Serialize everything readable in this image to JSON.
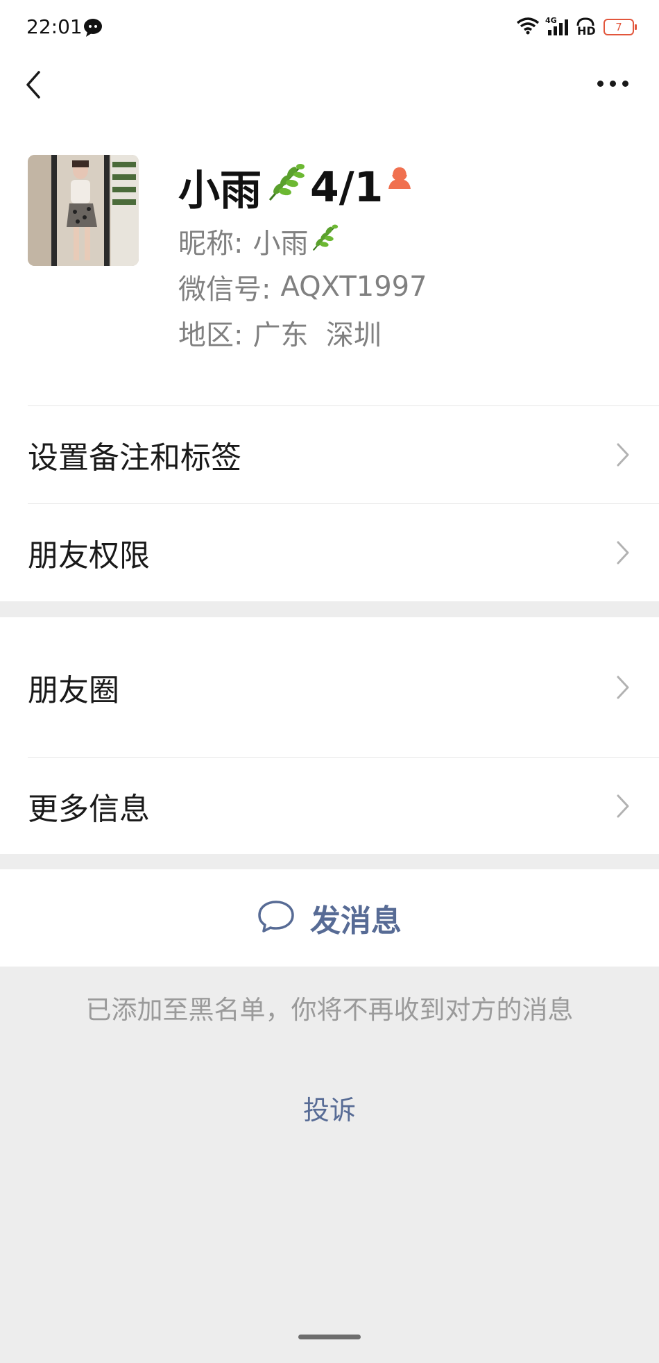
{
  "status_bar": {
    "time": "22:01",
    "network": "4G",
    "hd": "HD",
    "battery": "7"
  },
  "profile": {
    "name": "小雨",
    "name_suffix": "4/1",
    "nickname_label": "昵称:",
    "nickname_value": "小雨",
    "wechat_id_label": "微信号:",
    "wechat_id_value": "AQXT1997",
    "region_label": "地区:",
    "region_value": "广东  深圳"
  },
  "menu": [
    {
      "label": "设置备注和标签"
    },
    {
      "label": "朋友权限"
    },
    {
      "label": "朋友圈"
    },
    {
      "label": "更多信息"
    }
  ],
  "send_message": {
    "label": "发消息"
  },
  "blacklist_note": "已添加至黑名单，你将不再收到对方的消息",
  "complain_link": "投诉",
  "colors": {
    "link": "#576b95",
    "gender_female": "#f0704f",
    "battery": "#e2563c"
  }
}
